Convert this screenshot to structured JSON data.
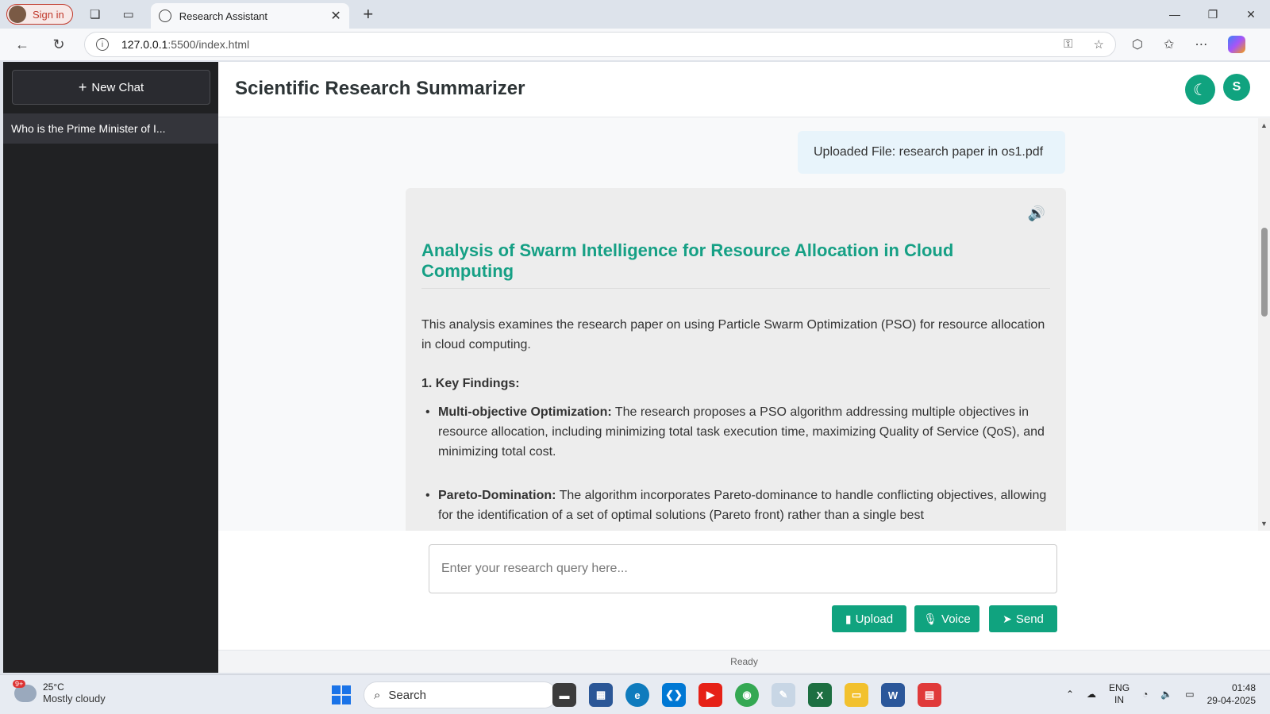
{
  "browser": {
    "sign_in": "Sign in",
    "tab_title": "Research Assistant",
    "url_host": "127.0.0.1",
    "url_path": ":5500/index.html"
  },
  "sidebar": {
    "new_chat": "New Chat",
    "history": [
      "Who is the Prime Minister of I..."
    ]
  },
  "header": {
    "title": "Scientific Research Summarizer",
    "avatar_initial": "S"
  },
  "chat": {
    "uploaded_file": "Uploaded File: research paper in os1.pdf",
    "report_title": "Analysis of Swarm Intelligence for Resource Allocation in Cloud Computing",
    "intro": "This analysis examines the research paper on using Particle Swarm Optimization (PSO) for resource allocation in cloud computing.",
    "section_heading": "1. Key Findings:",
    "bullets": [
      {
        "label": "Multi-objective Optimization:",
        "text": " The research proposes a PSO algorithm addressing multiple objectives in resource allocation, including minimizing total task execution time, maximizing Quality of Service (QoS), and minimizing total cost."
      },
      {
        "label": "Pareto-Domination:",
        "text": " The algorithm incorporates Pareto-dominance to handle conflicting objectives, allowing for the identification of a set of optimal solutions (Pareto front) rather than a single best"
      }
    ]
  },
  "input": {
    "placeholder": "Enter your research query here...",
    "upload_label": "Upload",
    "voice_label": "Voice",
    "send_label": "Send"
  },
  "status": "Ready",
  "taskbar": {
    "weather_badge": "9+",
    "temperature": "25°C",
    "condition": "Mostly cloudy",
    "search_label": "Search",
    "lang_top": "ENG",
    "lang_bottom": "IN",
    "time": "01:48",
    "date": "29-04-2025"
  },
  "colors": {
    "accent": "#10a37f",
    "report_title": "#16a085",
    "sidebar_bg": "#202123"
  }
}
